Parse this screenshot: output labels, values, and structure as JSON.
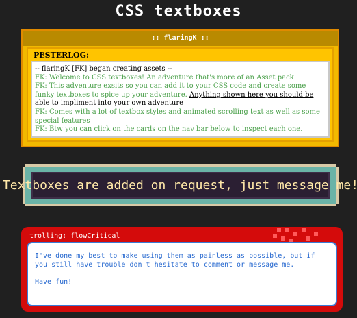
{
  "page": {
    "title": "CSS textboxes"
  },
  "pesterlog": {
    "header": ":: flaringK ::",
    "label": "PESTERLOG:",
    "lines": [
      {
        "kind": "sys",
        "text": "-- flaringK [FK] began creating assets --"
      },
      {
        "kind": "fk",
        "text": "FK: Welcome to CSS textboxes! An adventure that's more of an Asset pack"
      },
      {
        "kind": "fk",
        "text": "FK: This adventure exsits so you can add it to your CSS code and create some funky textboxes to spice up your adventure."
      },
      {
        "kind": "underline",
        "text": "Anything shown here you should be able to impliment into your own adventure"
      },
      {
        "kind": "fk",
        "text": "FK: Comes with a lot of textbox styles and animated scrolling text as well as some special features"
      },
      {
        "kind": "fk",
        "text": "FK: Btw you can click on the cards on the nav bar below to inspect each one."
      }
    ]
  },
  "banner": {
    "text": "Textboxes are added on request, just message me!"
  },
  "trolling": {
    "header": "trolling: flowCritical",
    "paragraph1": "I've done my best to make using them as painless as possible, but if you still have trouble don't hesitate to comment or message me.",
    "paragraph2": "Have fun!"
  },
  "colors": {
    "background": "#202020",
    "pester_yellow": "#f2b900",
    "fk_green": "#4aa04a",
    "troll_red": "#d40b0b",
    "troll_blue_text": "#2a6bd0",
    "banner_dark": "#2b1f33",
    "banner_teal": "#6ab3a7"
  }
}
